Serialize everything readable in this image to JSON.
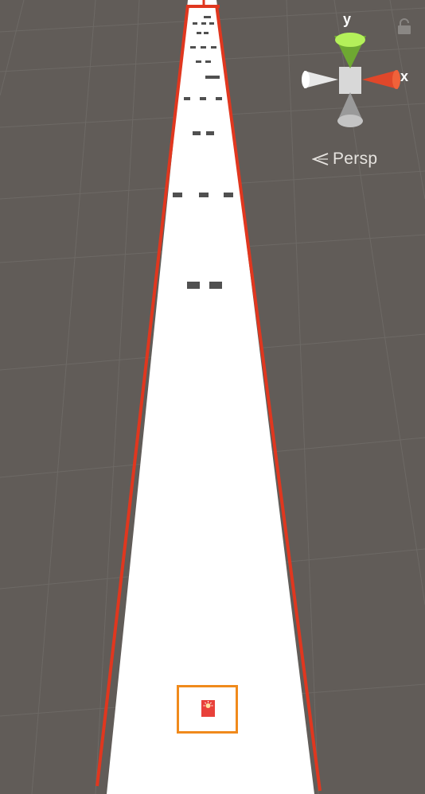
{
  "scene_view": {
    "projection_label": "Persp",
    "gizmo": {
      "axis_y_label": "y",
      "axis_x_label": "x",
      "colors": {
        "y": "#8fd63a",
        "x": "#e0472a",
        "neutral": "#c8c8c8"
      }
    },
    "colors": {
      "background": "#615c58",
      "grid_line": "#6e6a66",
      "track": "#ffffff",
      "track_edge": "#e0371f",
      "selection": "#f08a1c",
      "selected_object": "#e8413a",
      "obstacle": "#505050"
    },
    "icons": {
      "lock": "lock-icon",
      "persp": "chevron-left-icon",
      "object": "sun-icon"
    }
  }
}
